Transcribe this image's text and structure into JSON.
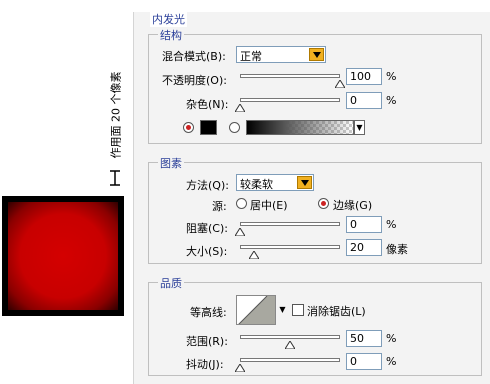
{
  "preview": {
    "vertical_label": "作用面 20 个像素"
  },
  "dialog": {
    "title": "内发光",
    "structure": {
      "group_label": "结构",
      "blend_mode": {
        "label": "混合模式(B):",
        "value": "正常"
      },
      "opacity": {
        "label": "不透明度(O):",
        "value": "100",
        "unit": "%",
        "level": 1.0
      },
      "noise": {
        "label": "杂色(N):",
        "value": "0",
        "unit": "%",
        "level": 0.0
      },
      "color_mode": "solid",
      "color": "#000000"
    },
    "elements": {
      "group_label": "图素",
      "technique": {
        "label": "方法(Q):",
        "value": "较柔软"
      },
      "source": {
        "label": "源:",
        "center_label": "居中(E)",
        "edge_label": "边缘(G)",
        "selected": "edge"
      },
      "choke": {
        "label": "阻塞(C):",
        "value": "0",
        "unit": "%",
        "level": 0.0
      },
      "size": {
        "label": "大小(S):",
        "value": "20",
        "unit": "像素",
        "level": 0.08
      }
    },
    "quality": {
      "group_label": "品质",
      "contour": {
        "label": "等高线:"
      },
      "anti_alias": {
        "label": "消除锯齿(L)",
        "checked": false
      },
      "range": {
        "label": "范围(R):",
        "value": "50",
        "unit": "%",
        "level": 0.5
      },
      "jitter": {
        "label": "抖动(J):",
        "value": "0",
        "unit": "%",
        "level": 0.0
      }
    }
  },
  "colors": {
    "group_label_color": "#2a3f99",
    "accent_dropdown": "#f0b020",
    "glow_red": "#d40000"
  }
}
